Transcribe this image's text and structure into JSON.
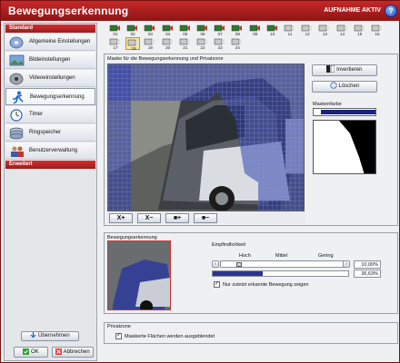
{
  "window": {
    "title": "Bewegungserkennung",
    "record_status": "AUFNAHME AKTIV",
    "help_label": "?"
  },
  "sidebar": {
    "section_standard": "Standard",
    "section_extended": "Erweitert",
    "items": [
      {
        "label": "Allgemeine Einstellungen",
        "icon": "settings-disc-icon"
      },
      {
        "label": "Bildeinstellungen",
        "icon": "picture-icon"
      },
      {
        "label": "Videoeinstellungen",
        "icon": "film-icon"
      },
      {
        "label": "Bewegungserkennung",
        "icon": "running-man-icon"
      },
      {
        "label": "Timer",
        "icon": "clock-icon"
      },
      {
        "label": "Ringspeicher",
        "icon": "disc-stack-icon"
      },
      {
        "label": "Benutzerverwaltung",
        "icon": "users-icon"
      }
    ],
    "apply_label": "Übernehmen",
    "ok_label": "OK",
    "cancel_label": "Abbrechen"
  },
  "cameras": {
    "row1": [
      "01",
      "02",
      "03",
      "04",
      "05",
      "06",
      "07",
      "08",
      "09",
      "10",
      "11",
      "12",
      "13",
      "14",
      "15",
      "16"
    ],
    "row2": [
      "17",
      "18",
      "19",
      "20",
      "21",
      "22",
      "23",
      "24"
    ],
    "selected": "18"
  },
  "mask": {
    "title": "Maske für die Bewegungserkennung und Privatzone",
    "invert_label": "Invertieren",
    "delete_label": "Löschen",
    "color_label": "Maskenfarbe",
    "mask_color": "#1a237e",
    "tools": [
      "X+",
      "X−",
      "■+",
      "■−"
    ]
  },
  "motion": {
    "title": "Bewegungserkennung",
    "sensitivity_label": "Empfindlichkeit",
    "high": "Hoch",
    "medium": "Mittel",
    "low": "Gering",
    "sensitivity_value": "10,00%",
    "detected_value": "36,63%",
    "detected_fraction": 0.3663,
    "show_last_label": "Nur zuletzt erkannte Bewegung zeigen"
  },
  "privacy": {
    "title": "Privatzone",
    "hidden_label": "Maskierte Flächen werden ausgeblendet"
  }
}
